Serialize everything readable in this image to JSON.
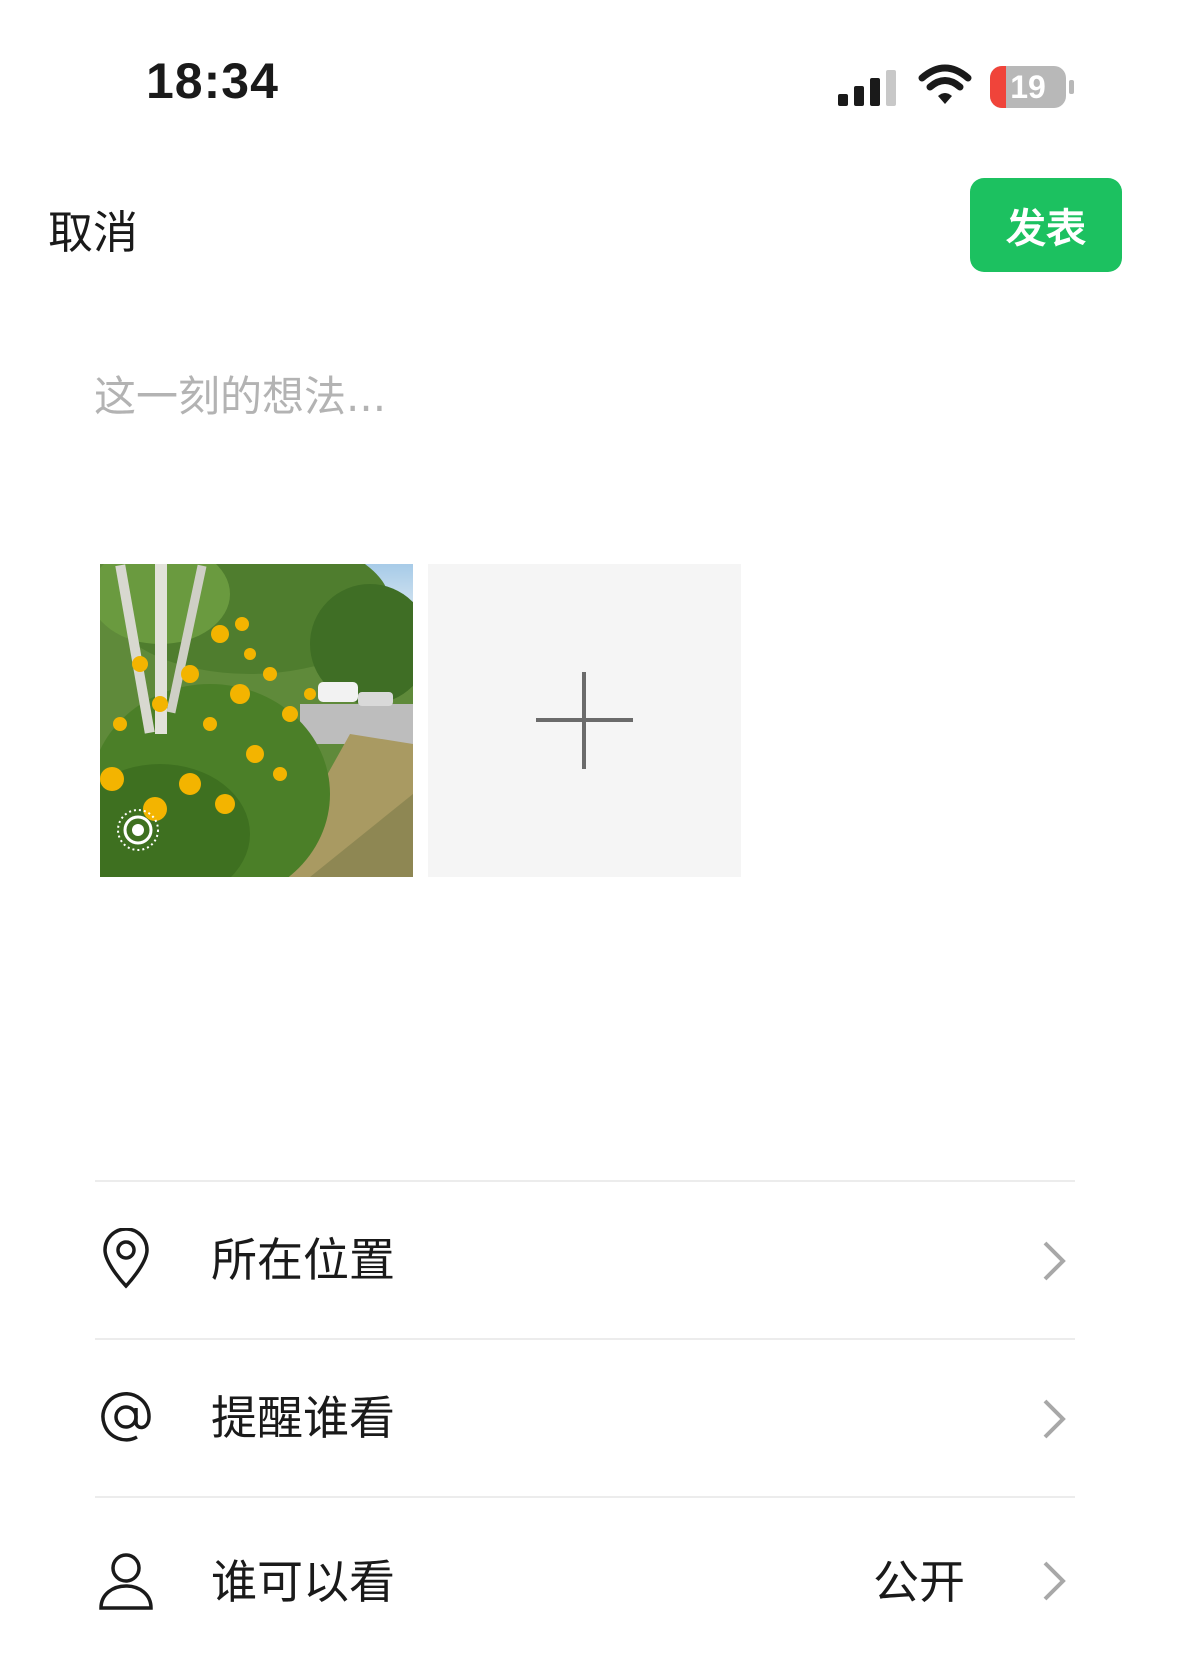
{
  "status_bar": {
    "time": "18:34",
    "battery_level": "19",
    "battery_color": "#f0443a",
    "icons": [
      "cellular-signal-icon",
      "wifi-icon",
      "battery-icon"
    ]
  },
  "header": {
    "cancel_label": "取消",
    "publish_label": "发表",
    "publish_color": "#1cc160"
  },
  "composer": {
    "placeholder": "这一刻的想法...",
    "value": ""
  },
  "media": {
    "photo_count": 1,
    "live_photo_icon": "live-photo-icon",
    "add_icon": "plus-icon"
  },
  "options": [
    {
      "icon": "location-pin-icon",
      "label": "所在位置",
      "value": ""
    },
    {
      "icon": "at-sign-icon",
      "label": "提醒谁看",
      "value": ""
    },
    {
      "icon": "person-icon",
      "label": "谁可以看",
      "value": "公开"
    }
  ]
}
